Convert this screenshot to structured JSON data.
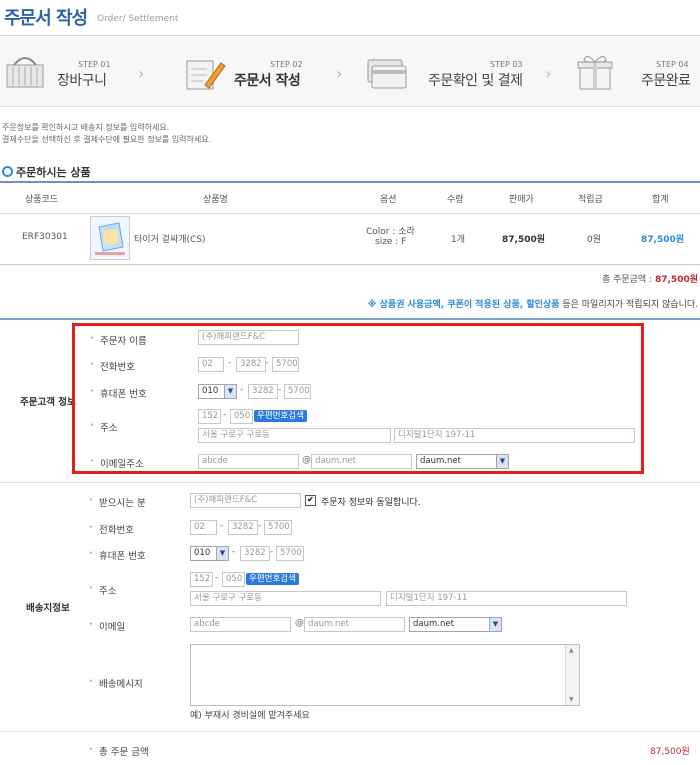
{
  "page": {
    "title": "주문서 작성",
    "subtitle": "Order/ Settlement"
  },
  "steps": [
    {
      "no": "STEP 01",
      "name": "장바구니",
      "icon": "basket-icon"
    },
    {
      "no": "STEP 02",
      "name": "주문서 작성",
      "icon": "pencil-note-icon"
    },
    {
      "no": "STEP 03",
      "name": "주문확인 및 결제",
      "icon": "credit-card-icon"
    },
    {
      "no": "STEP 04",
      "name": "주문완료",
      "icon": "gift-box-icon"
    }
  ],
  "intro": {
    "line1": "주문정보를 확인하시고 배송지 정보를 입력하세요.",
    "line2": "결제수단을 선택하신 후 결제수단에 필요한 정보를 입력하세요."
  },
  "products_section": {
    "title": "주문하시는 상품",
    "headers": [
      "상품코드",
      "상품명",
      "옵션",
      "수량",
      "판매가",
      "적립금",
      "합계"
    ],
    "rows": [
      {
        "code": "ERF30301",
        "name": "타이거 겉싸개(CS)",
        "option_color": "Color : 소라",
        "option_size": "size : F",
        "qty": "1개",
        "price": "87,500원",
        "points": "0원",
        "total": "87,500원"
      }
    ],
    "total_label": "총 주문금액 :",
    "total_value": "87,500원",
    "notice_prefix": "※ 상품권 사용금액, 쿠폰이 적용된 상품, 할인상품",
    "notice_suffix": " 등은 마일리지가 적립되지 않습니다."
  },
  "orderer": {
    "section_label": "주문고객 정보",
    "name_label": "주문자 이름",
    "name_value": "(주)해피랜드F&C",
    "phone_label": "전화번호",
    "phone": [
      "02",
      "3282",
      "5700"
    ],
    "mobile_label": "휴대폰 번호",
    "mobile": [
      "010",
      "3282",
      "5700"
    ],
    "address_label": "주소",
    "zip": [
      "152",
      "050"
    ],
    "zip_button": "우편번호검색",
    "addr1": "서울 구로구 구로동",
    "addr2": "디지털1단지 197-11",
    "email_label": "이메일주소",
    "email_id": "abcde",
    "email_at": "@",
    "email_domain": "daum.net",
    "email_select": "daum.net"
  },
  "shipping": {
    "section_label": "배송지정보",
    "recipient_label": "받으시는 분",
    "recipient_value": "(주)해피랜드F&C",
    "same_as_orderer": "주문자 정보와 동일합니다.",
    "same_checked": "✔",
    "phone_label": "전화번호",
    "phone": [
      "02",
      "3282",
      "5700"
    ],
    "mobile_label": "휴대폰 번호",
    "mobile": [
      "010",
      "3282",
      "5700"
    ],
    "address_label": "주소",
    "zip": [
      "152",
      "050"
    ],
    "zip_button": "우편번호검색",
    "addr1": "서울 구로구 구로동",
    "addr2": "디지털1단지 197-11",
    "email_label": "이메일",
    "email_id": "abcde",
    "email_at": "@",
    "email_domain": "daum.net",
    "email_select": "daum.net",
    "message_label": "배송메시지",
    "message_example": "예) 부재시 경비실에 맡겨주세요",
    "total_label": "총 주문 금액",
    "total_value": "87,500원"
  },
  "colors": {
    "brand_blue": "#2a63a8",
    "accent_red": "#c0282f",
    "highlight_box": "#e32119"
  }
}
